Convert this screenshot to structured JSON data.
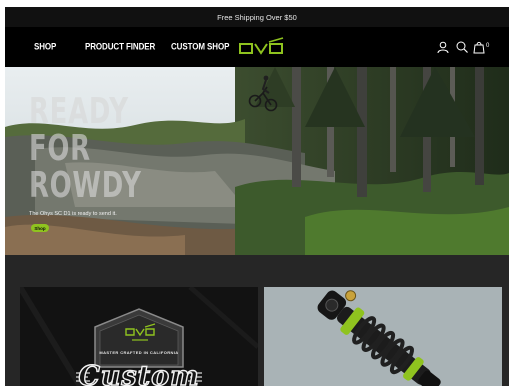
{
  "promo_bar": {
    "text": "Free Shipping Over $50"
  },
  "nav": {
    "links": [
      "SHOP",
      "PRODUCT FINDER",
      "CUSTOM SHOP"
    ],
    "cart_count": "0",
    "icons": [
      "user-icon",
      "search-icon",
      "cart-icon"
    ]
  },
  "brand": {
    "accent": "#8fc31f",
    "nav_bg": "#000000",
    "section_bg": "#262626"
  },
  "hero": {
    "headline": [
      "READY",
      "FOR",
      "ROWDY"
    ],
    "subtext": "The Ohys SC D1 is ready to send it.",
    "button_label": "Shop"
  },
  "promo_cards": {
    "custom_card": {
      "badge_caption": "MASTER CRAFTED IN CALIFORNIA",
      "badge_word": "Custom"
    }
  }
}
